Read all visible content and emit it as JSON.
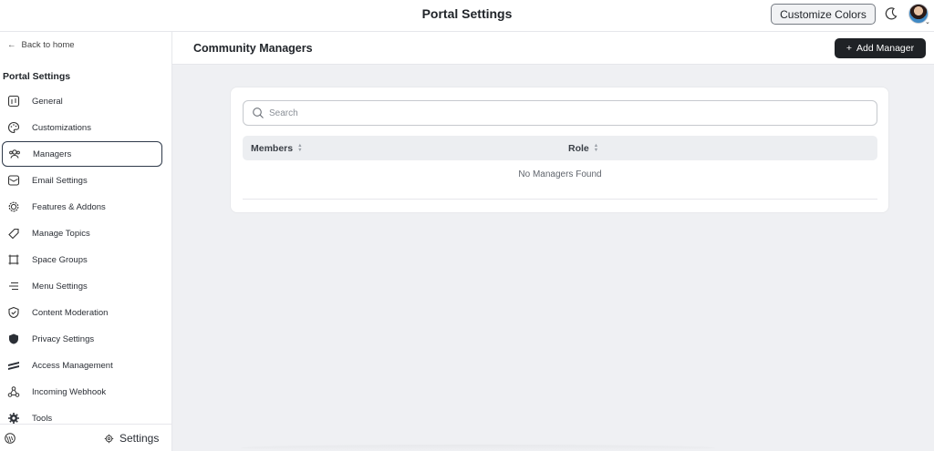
{
  "header": {
    "title": "Portal Settings",
    "customize_label": "Customize Colors"
  },
  "sidebar": {
    "back_label": "Back to home",
    "heading": "Portal Settings",
    "items": [
      {
        "label": "General",
        "icon": "info-box-icon"
      },
      {
        "label": "Customizations",
        "icon": "palette-icon"
      },
      {
        "label": "Managers",
        "icon": "users-icon",
        "active": true
      },
      {
        "label": "Email Settings",
        "icon": "envelope-icon"
      },
      {
        "label": "Features & Addons",
        "icon": "chip-icon"
      },
      {
        "label": "Manage Topics",
        "icon": "tag-icon"
      },
      {
        "label": "Space Groups",
        "icon": "frame-icon"
      },
      {
        "label": "Menu Settings",
        "icon": "menu-lines-icon"
      },
      {
        "label": "Content Moderation",
        "icon": "shield-check-icon"
      },
      {
        "label": "Privacy Settings",
        "icon": "shield-filled-icon"
      },
      {
        "label": "Access Management",
        "icon": "stripes-icon"
      },
      {
        "label": "Incoming Webhook",
        "icon": "webhook-icon"
      },
      {
        "label": "Tools",
        "icon": "gear-icon"
      }
    ],
    "footer_settings_label": "Settings"
  },
  "main": {
    "title": "Community Managers",
    "add_button_label": "Add Manager",
    "search_placeholder": "Search",
    "columns": [
      "Members",
      "Role"
    ],
    "empty_text": "No Managers Found"
  },
  "colors": {
    "accent_dark": "#1f2226",
    "background": "#eff0f3"
  }
}
